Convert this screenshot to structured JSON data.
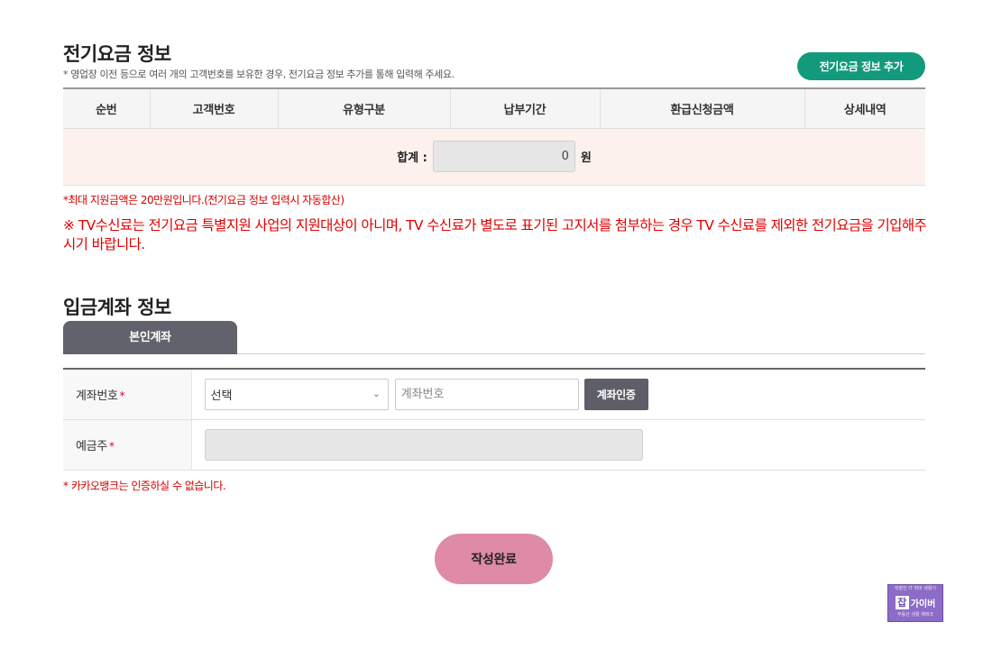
{
  "bill_section": {
    "title": "전기요금 정보",
    "note": "* 영업장 이전 등으로 여러 개의 고객번호를 보유한 경우, 전기요금 정보 추가를 통해 입력해 주세요.",
    "add_button": "전기요금 정보 추가",
    "columns": [
      "순번",
      "고객번호",
      "유형구분",
      "납부기간",
      "환급신청금액",
      "상세내역"
    ],
    "total_label": "합계 :",
    "total_value": "0",
    "total_unit": "원"
  },
  "notices": {
    "max_support": "*최대 지원금액은 20만원입니다.(전기요금 정보 입력시 자동합산)",
    "tv_fee": "※ TV수신료는 전기요금 특별지원 사업의 지원대상이 아니며, TV 수신료가 별도로 표기된 고지서를 첨부하는 경우 TV 수신료를 제외한 전기요금을 기입해주시기 바랍니다."
  },
  "account_section": {
    "title": "입금계좌 정보",
    "tab": "본인계좌",
    "account_label": "계좌번호",
    "required_mark": "*",
    "bank_select": "선택",
    "account_placeholder": "계좌번호",
    "verify_button": "계좌인증",
    "holder_label": "예금주",
    "kakao_note": "* 카카오뱅크는 인증하실 수 없습니다."
  },
  "submit_button": "작성완료",
  "watermark": {
    "line1": "직장인 IT 취미 생활기",
    "char": "잡",
    "name": "가이버",
    "line3": "부동산 생활 재테크"
  }
}
